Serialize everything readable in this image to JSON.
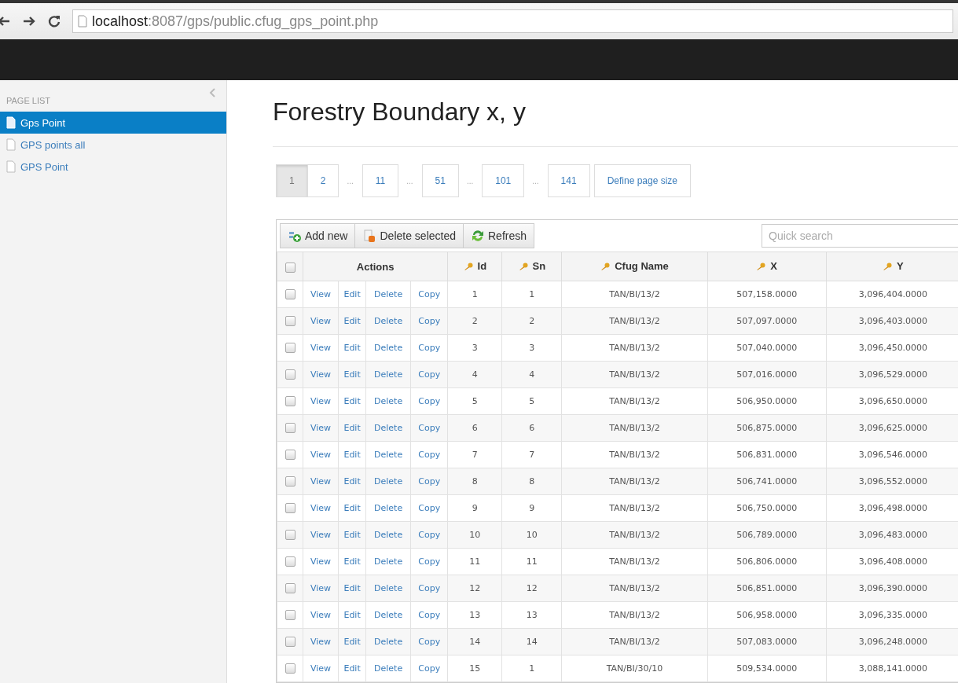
{
  "browser": {
    "url_host": "localhost",
    "url_rest": ":8087/gps/public.cfug_gps_point.php"
  },
  "sidebar": {
    "heading": "PAGE LIST",
    "items": [
      {
        "label": "Gps Point",
        "selected": true
      },
      {
        "label": "GPS points all",
        "selected": false
      },
      {
        "label": "GPS Point",
        "selected": false
      }
    ]
  },
  "page_title": "Forestry Boundary x, y",
  "pagination": [
    {
      "label": "1",
      "kind": "page",
      "selected": true
    },
    {
      "label": "2",
      "kind": "page",
      "selected": false
    },
    {
      "label": "...",
      "kind": "ellipsis"
    },
    {
      "label": "11",
      "kind": "page",
      "selected": false
    },
    {
      "label": "...",
      "kind": "ellipsis"
    },
    {
      "label": "51",
      "kind": "page",
      "selected": false
    },
    {
      "label": "...",
      "kind": "ellipsis"
    },
    {
      "label": "101",
      "kind": "page",
      "selected": false
    },
    {
      "label": "...",
      "kind": "ellipsis"
    },
    {
      "label": "141",
      "kind": "page",
      "selected": false
    },
    {
      "label": "Define page size",
      "kind": "button"
    }
  ],
  "toolbar": {
    "buttons": [
      {
        "label": "Add new",
        "kind": "add"
      },
      {
        "label": "Delete selected",
        "kind": "delete"
      },
      {
        "label": "Refresh",
        "kind": "refresh"
      }
    ],
    "search": {
      "placeholder": "Quick search"
    }
  },
  "table": {
    "select_all_checked": false,
    "actions_header": "Actions",
    "columns": [
      "Id",
      "Sn",
      "Cfug Name",
      "X",
      "Y"
    ],
    "rows": [
      {
        "checked": false,
        "actions": [
          "View",
          "Edit",
          "Delete",
          "Copy"
        ],
        "cells": [
          "1",
          "1",
          "TAN/BI/13/2",
          "507,158.0000",
          "3,096,404.0000"
        ]
      },
      {
        "checked": false,
        "actions": [
          "View",
          "Edit",
          "Delete",
          "Copy"
        ],
        "cells": [
          "2",
          "2",
          "TAN/BI/13/2",
          "507,097.0000",
          "3,096,403.0000"
        ]
      },
      {
        "checked": false,
        "actions": [
          "View",
          "Edit",
          "Delete",
          "Copy"
        ],
        "cells": [
          "3",
          "3",
          "TAN/BI/13/2",
          "507,040.0000",
          "3,096,450.0000"
        ]
      },
      {
        "checked": false,
        "actions": [
          "View",
          "Edit",
          "Delete",
          "Copy"
        ],
        "cells": [
          "4",
          "4",
          "TAN/BI/13/2",
          "507,016.0000",
          "3,096,529.0000"
        ]
      },
      {
        "checked": false,
        "actions": [
          "View",
          "Edit",
          "Delete",
          "Copy"
        ],
        "cells": [
          "5",
          "5",
          "TAN/BI/13/2",
          "506,950.0000",
          "3,096,650.0000"
        ]
      },
      {
        "checked": false,
        "actions": [
          "View",
          "Edit",
          "Delete",
          "Copy"
        ],
        "cells": [
          "6",
          "6",
          "TAN/BI/13/2",
          "506,875.0000",
          "3,096,625.0000"
        ]
      },
      {
        "checked": false,
        "actions": [
          "View",
          "Edit",
          "Delete",
          "Copy"
        ],
        "cells": [
          "7",
          "7",
          "TAN/BI/13/2",
          "506,831.0000",
          "3,096,546.0000"
        ]
      },
      {
        "checked": false,
        "actions": [
          "View",
          "Edit",
          "Delete",
          "Copy"
        ],
        "cells": [
          "8",
          "8",
          "TAN/BI/13/2",
          "506,741.0000",
          "3,096,552.0000"
        ]
      },
      {
        "checked": false,
        "actions": [
          "View",
          "Edit",
          "Delete",
          "Copy"
        ],
        "cells": [
          "9",
          "9",
          "TAN/BI/13/2",
          "506,750.0000",
          "3,096,498.0000"
        ]
      },
      {
        "checked": false,
        "actions": [
          "View",
          "Edit",
          "Delete",
          "Copy"
        ],
        "cells": [
          "10",
          "10",
          "TAN/BI/13/2",
          "506,789.0000",
          "3,096,483.0000"
        ]
      },
      {
        "checked": false,
        "actions": [
          "View",
          "Edit",
          "Delete",
          "Copy"
        ],
        "cells": [
          "11",
          "11",
          "TAN/BI/13/2",
          "506,806.0000",
          "3,096,408.0000"
        ]
      },
      {
        "checked": false,
        "actions": [
          "View",
          "Edit",
          "Delete",
          "Copy"
        ],
        "cells": [
          "12",
          "12",
          "TAN/BI/13/2",
          "506,851.0000",
          "3,096,390.0000"
        ]
      },
      {
        "checked": false,
        "actions": [
          "View",
          "Edit",
          "Delete",
          "Copy"
        ],
        "cells": [
          "13",
          "13",
          "TAN/BI/13/2",
          "506,958.0000",
          "3,096,335.0000"
        ]
      },
      {
        "checked": false,
        "actions": [
          "View",
          "Edit",
          "Delete",
          "Copy"
        ],
        "cells": [
          "14",
          "14",
          "TAN/BI/13/2",
          "507,083.0000",
          "3,096,248.0000"
        ]
      },
      {
        "checked": false,
        "actions": [
          "View",
          "Edit",
          "Delete",
          "Copy"
        ],
        "cells": [
          "15",
          "1",
          "TAN/BI/30/10",
          "509,534.0000",
          "3,088,141.0000"
        ]
      }
    ]
  }
}
